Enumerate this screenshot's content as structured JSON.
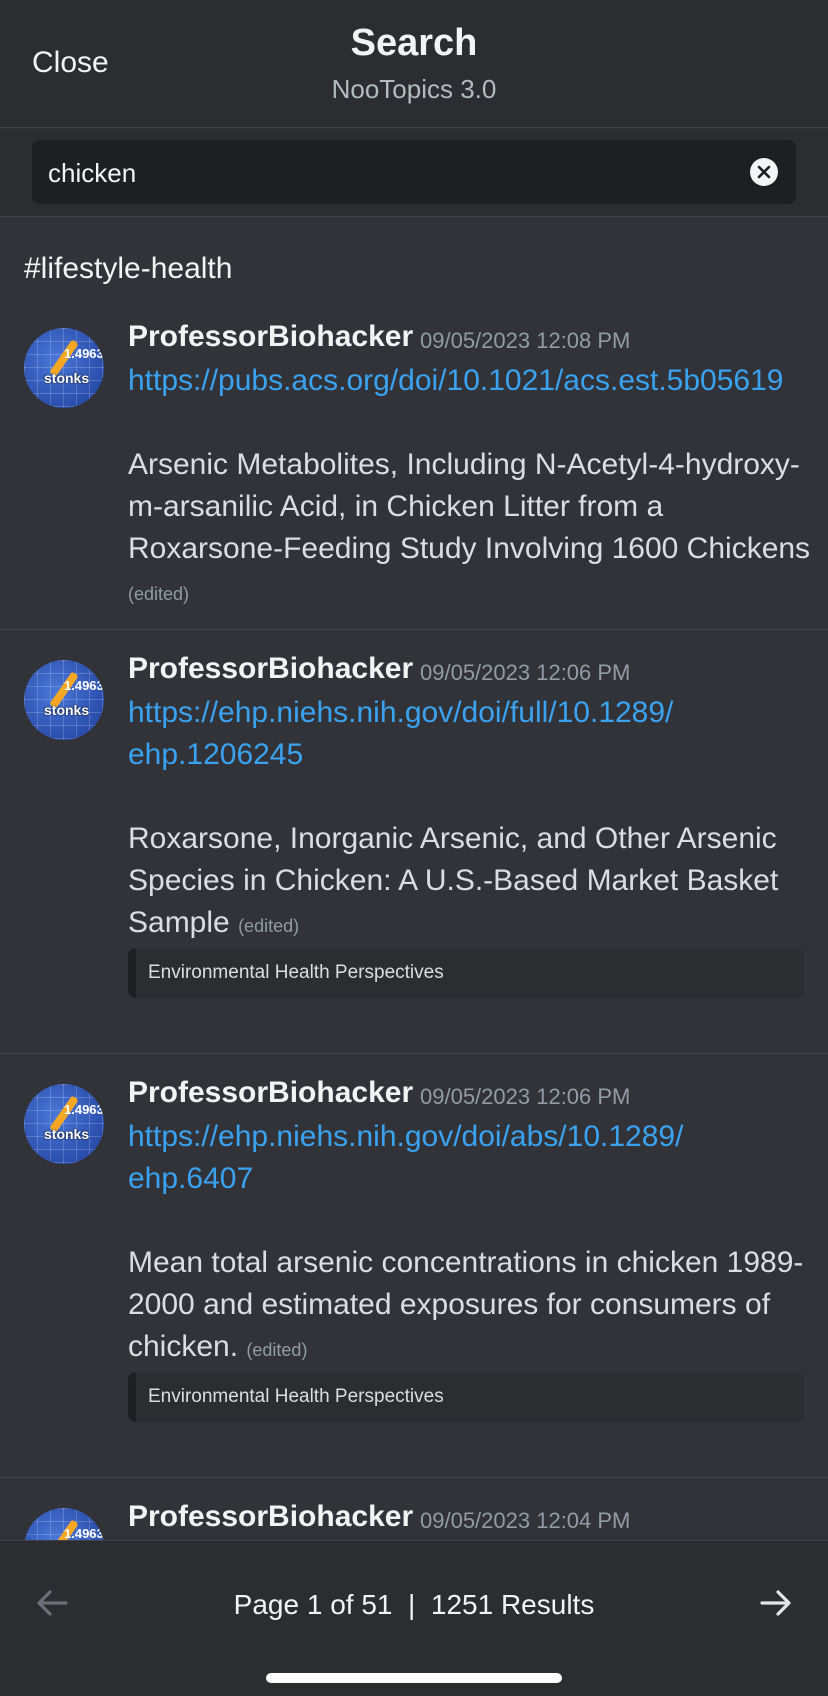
{
  "header": {
    "close_label": "Close",
    "title": "Search",
    "subtitle": "NooTopics 3.0"
  },
  "search": {
    "query": "chicken"
  },
  "channel": "#lifestyle-health",
  "messages": [
    {
      "author": "ProfessorBiohacker",
      "timestamp": "09/05/2023 12:08 PM",
      "link": "https://pubs.acs.org/doi/10.1021/acs.est.5b05619",
      "text": "Arsenic Metabolites, Including N-Acetyl-4-hydroxy-m-arsanilic Acid, in Chicken Litter from a Roxarsone-Feeding Study Involving 1600 Chickens",
      "edited": "(edited)"
    },
    {
      "author": "ProfessorBiohacker",
      "timestamp": "09/05/2023 12:06 PM",
      "link": "https://ehp.niehs.nih.gov/doi/full/10.1289/ehp.1206245",
      "text": "Roxarsone, Inorganic Arsenic, and Other Arsenic Species in Chicken: A U.S.-Based Market Basket Sample",
      "edited": "(edited)",
      "embed": "Environmental Health Perspectives"
    },
    {
      "author": "ProfessorBiohacker",
      "timestamp": "09/05/2023 12:06 PM",
      "link": "https://ehp.niehs.nih.gov/doi/abs/10.1289/ehp.6407",
      "text": "Mean total arsenic concentrations in chicken 1989-2000 and estimated exposures for consumers of chicken.",
      "edited": "(edited)",
      "embed": "Environmental Health Perspectives"
    },
    {
      "author": "ProfessorBiohacker",
      "timestamp": "09/05/2023 12:04 PM"
    }
  ],
  "avatar": {
    "number": "1.4963",
    "word": "stonks"
  },
  "footer": {
    "page_label": "Page 1 of 51",
    "separator": "|",
    "results_label": "1251 Results"
  },
  "colors": {
    "background": "#313338",
    "header": "#2b2d31",
    "link": "#3ba2f0"
  }
}
